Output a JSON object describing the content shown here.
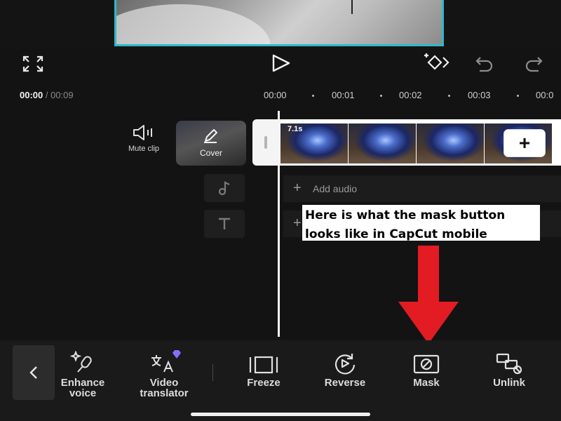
{
  "timeline": {
    "current_time": "00:00",
    "total_time": "/ 00:09",
    "ruler": [
      "00:00",
      "00:01",
      "00:02",
      "00:03",
      "00:0"
    ]
  },
  "tracks": {
    "mute_label": "Mute clip",
    "cover_label": "Cover",
    "clip_duration": "7.1s",
    "add_clip_symbol": "+",
    "add_audio_label": "Add audio",
    "plus_symbol": "+"
  },
  "annotation": {
    "text": "Here is what the mask button looks like in CapCut mobile",
    "arrow_color": "#e31b23"
  },
  "toolbar": {
    "back_symbol": "<",
    "items": [
      {
        "label": "Enhance\nvoice",
        "icon": "enhance-voice-icon"
      },
      {
        "label": "Video\ntranslator",
        "icon": "video-translator-icon"
      },
      {
        "label": "Freeze",
        "icon": "freeze-icon"
      },
      {
        "label": "Reverse",
        "icon": "reverse-icon"
      },
      {
        "label": "Mask",
        "icon": "mask-icon"
      },
      {
        "label": "Unlink",
        "icon": "unlink-icon"
      }
    ]
  },
  "colors": {
    "accent_frame": "#2fb8c8",
    "background": "#131313",
    "premium_badge": "#8a6cff"
  }
}
